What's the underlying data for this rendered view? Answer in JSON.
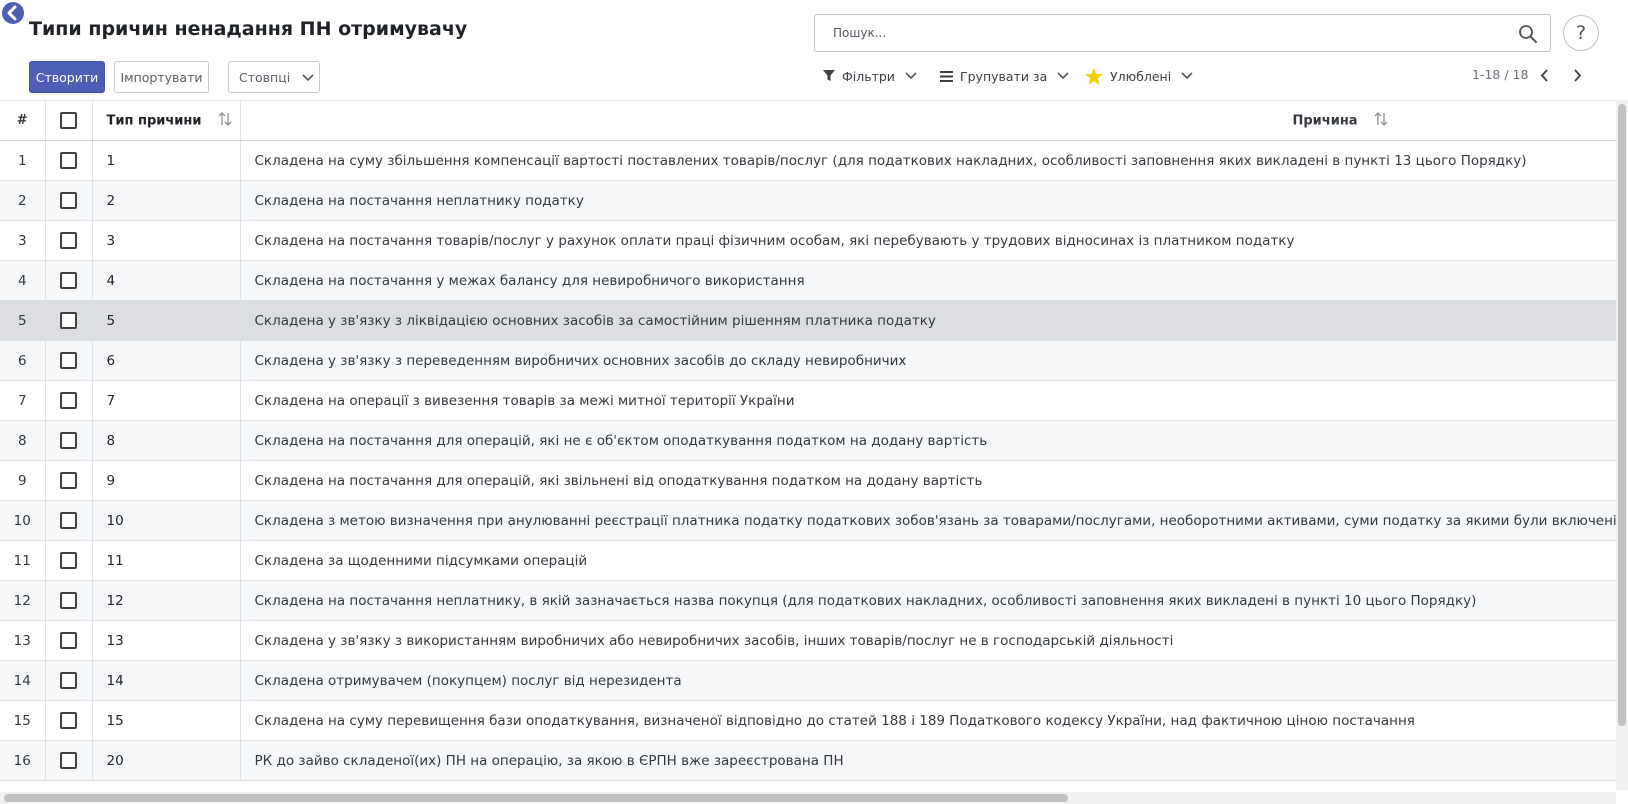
{
  "header": {
    "title": "Типи причин ненадання ПН отримувачу"
  },
  "search": {
    "placeholder": "Пошук...",
    "value": ""
  },
  "help": {
    "label": "?"
  },
  "actions": {
    "create_label": "Створити",
    "import_label": "Імпортувати",
    "columns_label": "Стовпці"
  },
  "toolbar": {
    "filters_label": "Фільтри",
    "group_by_label": "Групувати за",
    "favorites_label": "Улюблені"
  },
  "pager": {
    "text": "1-18 / 18"
  },
  "table": {
    "headers": {
      "num": "#",
      "type": "Тип причини",
      "reason": "Причина"
    },
    "rows": [
      {
        "num": "1",
        "type": "1",
        "reason": "Складена на суму збільшення компенсації вартості поставлених товарів/послуг (для податкових накладних, особливості заповнення яких викладені в пункті 13 цього Порядку)"
      },
      {
        "num": "2",
        "type": "2",
        "reason": "Складена на постачання неплатнику податку"
      },
      {
        "num": "3",
        "type": "3",
        "reason": "Складена на постачання товарів/послуг у рахунок оплати праці фізичним особам, які перебувають у трудових відносинах із платником податку"
      },
      {
        "num": "4",
        "type": "4",
        "reason": "Складена на постачання у межах балансу для невиробничого використання"
      },
      {
        "num": "5",
        "type": "5",
        "reason": "Складена у зв'язку з ліквідацією основних засобів за самостійним рішенням платника податку"
      },
      {
        "num": "6",
        "type": "6",
        "reason": "Складена у зв'язку з переведенням виробничих основних засобів до складу невиробничих"
      },
      {
        "num": "7",
        "type": "7",
        "reason": "Складена на операції з вивезення товарів за межі митної території України"
      },
      {
        "num": "8",
        "type": "8",
        "reason": "Складена на постачання для операцій, які не є об'єктом оподаткування податком на додану вартість"
      },
      {
        "num": "9",
        "type": "9",
        "reason": "Складена на постачання для операцій, які звільнені від оподаткування податком на додану вартість"
      },
      {
        "num": "10",
        "type": "10",
        "reason": "Складена з метою визначення при анулюванні реєстрації платника податку податкових зобов'язань за товарами/послугами, необоротними активами, суми податку за якими були включені до с"
      },
      {
        "num": "11",
        "type": "11",
        "reason": "Складена за щоденними підсумками операцій"
      },
      {
        "num": "12",
        "type": "12",
        "reason": "Складена на постачання неплатнику, в якій зазначається назва покупця (для податкових накладних, особливості заповнення яких викладені в пункті 10 цього Порядку)"
      },
      {
        "num": "13",
        "type": "13",
        "reason": "Складена у зв'язку з використанням виробничих або невиробничих засобів, інших товарів/послуг не в господарській діяльності"
      },
      {
        "num": "14",
        "type": "14",
        "reason": "Складена отримувачем (покупцем) послуг від нерезидента"
      },
      {
        "num": "15",
        "type": "15",
        "reason": "Складена на суму перевищення бази оподаткування, визначеної відповідно до статей 188 і 189 Податкового кодексу України, над фактичною ціною постачання"
      },
      {
        "num": "16",
        "type": "20",
        "reason": "РК до зайво складеної(их) ПН на операцію, за якою в ЄРПН вже зареєстрована ПН"
      }
    ]
  },
  "colors": {
    "primary": "#4f5fb8",
    "star": "#f3cc00",
    "hover_row": "#dcdde2"
  },
  "icons": {
    "back": "arrow-left-circle-icon",
    "search": "magnifier-icon",
    "filter": "funnel-icon",
    "group": "bars-icon",
    "favorite": "star-icon",
    "sort": "sort-arrows-icon"
  }
}
